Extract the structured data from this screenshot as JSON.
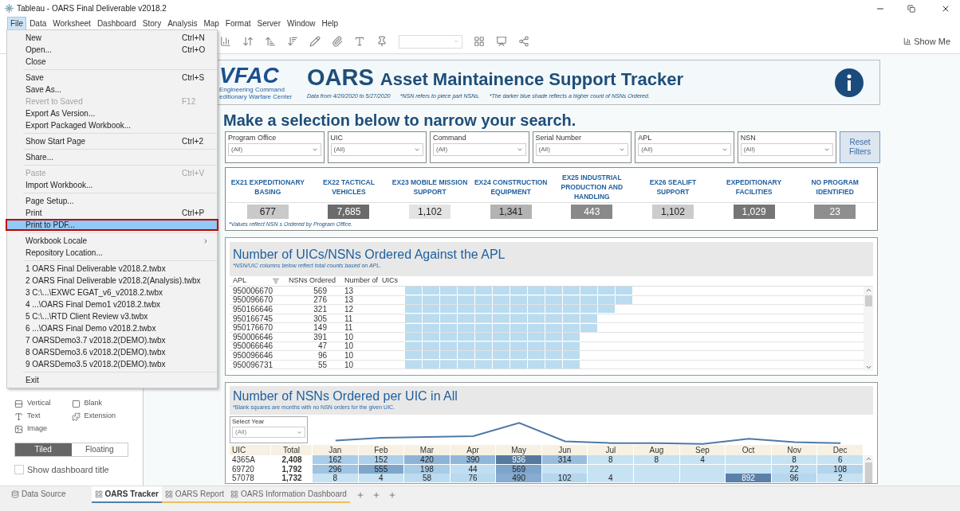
{
  "window": {
    "title": "Tableau - OARS Final Deliverable v2018.2"
  },
  "menu_bar": [
    {
      "label": "File",
      "selected": true
    },
    {
      "label": "Data",
      "selected": false
    },
    {
      "label": "Worksheet",
      "selected": false
    },
    {
      "label": "Dashboard",
      "selected": false
    },
    {
      "label": "Story",
      "selected": false
    },
    {
      "label": "Analysis",
      "selected": false
    },
    {
      "label": "Map",
      "selected": false
    },
    {
      "label": "Format",
      "selected": false
    },
    {
      "label": "Server",
      "selected": false
    },
    {
      "label": "Window",
      "selected": false
    },
    {
      "label": "Help",
      "selected": false
    }
  ],
  "toolbar": {
    "show_me": "Show Me"
  },
  "file_menu": {
    "groups": [
      [
        {
          "label": "New",
          "shortcut": "Ctrl+N",
          "disabled": false,
          "selected": false
        },
        {
          "label": "Open...",
          "shortcut": "Ctrl+O",
          "disabled": false,
          "selected": false
        },
        {
          "label": "Close",
          "disabled": false,
          "selected": false
        }
      ],
      [
        {
          "label": "Save",
          "shortcut": "Ctrl+S",
          "disabled": false,
          "selected": false
        },
        {
          "label": "Save As...",
          "disabled": false,
          "selected": false
        },
        {
          "label": "Revert to Saved",
          "shortcut": "F12",
          "disabled": true,
          "selected": false
        },
        {
          "label": "Export As Version...",
          "disabled": false,
          "selected": false
        },
        {
          "label": "Export Packaged Workbook...",
          "disabled": false,
          "selected": false
        }
      ],
      [
        {
          "label": "Show Start Page",
          "shortcut": "Ctrl+2",
          "disabled": false,
          "selected": false
        }
      ],
      [
        {
          "label": "Share...",
          "disabled": false,
          "selected": false
        }
      ],
      [
        {
          "label": "Paste",
          "shortcut": "Ctrl+V",
          "disabled": true,
          "selected": false
        },
        {
          "label": "Import Workbook...",
          "disabled": false,
          "selected": false
        }
      ],
      [
        {
          "label": "Page Setup...",
          "disabled": false,
          "selected": false
        },
        {
          "label": "Print",
          "shortcut": "Ctrl+P",
          "disabled": false,
          "selected": false
        },
        {
          "label": "Print to PDF...",
          "disabled": false,
          "selected": true
        }
      ],
      [
        {
          "label": "Workbook Locale",
          "submenu": true,
          "disabled": false,
          "selected": false
        },
        {
          "label": "Repository Location...",
          "disabled": false,
          "selected": false
        }
      ],
      [
        {
          "label": "1 OARS Final Deliverable v2018.2.twbx",
          "disabled": false,
          "selected": false
        },
        {
          "label": "2 OARS Final Deliverable v2018.2(Analysis).twbx",
          "disabled": false,
          "selected": false
        },
        {
          "label": "3 C:\\...\\EXWC EGAT_v6_v2018.2.twbx",
          "disabled": false,
          "selected": false
        },
        {
          "label": "4 ...\\OARS Final Demo1 v2018.2.twbx",
          "disabled": false,
          "selected": false
        },
        {
          "label": "5 C:\\...\\RTD Client Review v3.twbx",
          "disabled": false,
          "selected": false
        },
        {
          "label": "6 ...\\OARS Final Demo v2018.2.twbx",
          "disabled": false,
          "selected": false
        },
        {
          "label": "7 OARSDemo3.7 v2018.2(DEMO).twbx",
          "disabled": false,
          "selected": false
        },
        {
          "label": "8 OARSDemo3.6 v2018.2(DEMO).twbx",
          "disabled": false,
          "selected": false
        },
        {
          "label": "9 OARSDemo3.5 v2018.2(DEMO).twbx",
          "disabled": false,
          "selected": false
        }
      ],
      [
        {
          "label": "Exit",
          "disabled": false,
          "selected": false
        }
      ]
    ]
  },
  "sidebar": {
    "objects": [
      {
        "label": "Vertical",
        "kind": "vertical"
      },
      {
        "label": "Blank",
        "kind": "blank"
      },
      {
        "label": "Text",
        "kind": "text"
      },
      {
        "label": "Extension",
        "kind": "extension"
      },
      {
        "label": "Image",
        "kind": "image"
      }
    ],
    "layout": [
      {
        "label": "Tiled",
        "selected": true
      },
      {
        "label": "Floating",
        "selected": false
      }
    ],
    "show_title": {
      "label": "Show dashboard title",
      "checked": false
    }
  },
  "dashboard": {
    "header": {
      "logo": "VFAC",
      "logo_lines": [
        "Engineering Command",
        "editionary Warfare Center"
      ],
      "title_main": "OARS",
      "title": "Asset Maintainence Support Tracker",
      "notes": [
        "Data from 4/20/2020 to 5/27/2020",
        "*NSN refers to piece part NSNs.",
        "*The darker blue shade reflects a higher count of NSNs Ordered."
      ]
    },
    "heading": "Make a selection below to narrow your search.",
    "filters": [
      {
        "label": "Program Office",
        "value": "(All)"
      },
      {
        "label": "UIC",
        "value": "(All)"
      },
      {
        "label": "Command",
        "value": "(All)"
      },
      {
        "label": "Serial Number",
        "value": "(All)"
      },
      {
        "label": "APL",
        "value": "(All)"
      },
      {
        "label": "NSN",
        "value": "(All)"
      }
    ],
    "reset_button": "Reset Filters",
    "kpis": [
      {
        "label": "EX21 EXPEDITIONARY BASING",
        "value": "677",
        "color": "#c9c9c9"
      },
      {
        "label": "EX22 TACTICAL VEHICLES",
        "value": "7,685",
        "color": "#6b6b6b"
      },
      {
        "label": "EX23 MOBILE MISSION SUPPORT",
        "value": "1,102",
        "color": "#e3e3e3"
      },
      {
        "label": "EX24 CONSTRUCTION EQUIPMENT",
        "value": "1,341",
        "color": "#b3b3b3"
      },
      {
        "label": "EX25 INDUSTRIAL PRODUCTION AND HANDLING",
        "value": "443",
        "color": "#898989"
      },
      {
        "label": "EX26 SEALIFT SUPPORT",
        "value": "1,102",
        "color": "#cccccc"
      },
      {
        "label": "EXPEDITIONARY FACILITIES",
        "value": "1,029",
        "color": "#757575"
      },
      {
        "label": "NO PROGRAM IDENTIFIED",
        "value": "23",
        "color": "#8e8e8e"
      }
    ],
    "kpi_note": "*Values reflect NSN s Ordered by Program Office.",
    "apl_panel": {
      "title": "Number of UICs/NSNs Ordered Against the APL",
      "subtitle": "*NSN/UIC columns below reflect total counts based on APL.",
      "columns": [
        "APL",
        "NSNs Ordered",
        "Number of  UICs"
      ],
      "rows": [
        {
          "apl": "950006670",
          "nsns": "569",
          "uics": "13"
        },
        {
          "apl": "950096670",
          "nsns": "276",
          "uics": "13"
        },
        {
          "apl": "950166646",
          "nsns": "321",
          "uics": "12"
        },
        {
          "apl": "950166745",
          "nsns": "305",
          "uics": "11"
        },
        {
          "apl": "950176670",
          "nsns": "149",
          "uics": "11"
        },
        {
          "apl": "950006646",
          "nsns": "391",
          "uics": "10"
        },
        {
          "apl": "950066646",
          "nsns": "47",
          "uics": "10"
        },
        {
          "apl": "950096646",
          "nsns": "96",
          "uics": "10"
        },
        {
          "apl": "950096731",
          "nsns": "55",
          "uics": "10"
        }
      ]
    },
    "uic_panel": {
      "title": "Number of NSNs Ordered per UIC in All",
      "subtitle": "*Blank squares are months with no NSN orders for the given UIC.",
      "year_filter": {
        "label": "Select Year",
        "value": "(All)"
      },
      "columns": [
        "UIC",
        "Total",
        "Jan",
        "Feb",
        "Mar",
        "Apr",
        "May",
        "Jun",
        "Jul",
        "Aug",
        "Sep",
        "Oct",
        "Nov",
        "Dec"
      ],
      "rows": [
        {
          "uic": "4365A",
          "total": "2,408",
          "months": [
            {
              "v": "162",
              "color": "#a9cde8"
            },
            {
              "v": "152",
              "color": "#aed0ea"
            },
            {
              "v": "420",
              "color": "#8db4d6"
            },
            {
              "v": "390",
              "color": "#92b8d9"
            },
            {
              "v": "936",
              "color": "#55799f"
            },
            {
              "v": "314",
              "color": "#99bedd"
            },
            {
              "v": "8",
              "color": "#c6e2f3"
            },
            {
              "v": "8",
              "color": "#c6e2f3"
            },
            {
              "v": "4",
              "color": "#c6e2f3"
            },
            {
              "color": "#c6e2f3"
            },
            {
              "v": "8",
              "color": "#c6e2f3"
            },
            {
              "v": "6",
              "color": "#c6e2f3"
            }
          ]
        },
        {
          "uic": "69720",
          "total": "1,792",
          "months": [
            {
              "v": "296",
              "color": "#9fc4e1"
            },
            {
              "v": "555",
              "color": "#7ea6cc"
            },
            {
              "v": "198",
              "color": "#a8cbe6"
            },
            {
              "v": "44",
              "color": "#c0def1"
            },
            {
              "v": "569",
              "color": "#7da5cb"
            },
            {
              "color": "#c6e2f3"
            },
            {
              "color": "#c6e2f3"
            },
            {
              "color": "#c6e2f3"
            },
            {
              "color": "#c6e2f3"
            },
            {
              "color": "#c6e2f3"
            },
            {
              "v": "22",
              "color": "#c0def1"
            },
            {
              "v": "108",
              "color": "#b3d4ec"
            }
          ]
        },
        {
          "uic": "57078",
          "total": "1,732",
          "months": [
            {
              "v": "8",
              "color": "#c6e2f3"
            },
            {
              "v": "4",
              "color": "#c6e2f3"
            },
            {
              "v": "58",
              "color": "#bcdbf0"
            },
            {
              "v": "76",
              "color": "#b9d9ef"
            },
            {
              "v": "490",
              "color": "#86acd0"
            },
            {
              "v": "102",
              "color": "#b5d6ed"
            },
            {
              "v": "4",
              "color": "#c6e2f3"
            },
            {
              "color": "#c6e2f3"
            },
            {
              "color": "#c6e2f3"
            },
            {
              "v": "892",
              "color": "#5b80a8"
            },
            {
              "v": "96",
              "color": "#b7d7ee"
            },
            {
              "v": "2",
              "color": "#c6e2f3"
            }
          ]
        }
      ]
    }
  },
  "sheet_tabs": [
    {
      "label": "Data Source",
      "kind": "datasource",
      "selected": false
    },
    {
      "label": "OARS Tracker",
      "kind": "dashboard",
      "selected": true,
      "color": "#4f7fae"
    },
    {
      "label": "OARS Report",
      "kind": "dashboard",
      "selected": false,
      "color": "#e8c25a"
    },
    {
      "label": "OARS Information Dashboard",
      "kind": "dashboard",
      "selected": false,
      "color": "#e8c25a"
    }
  ]
}
